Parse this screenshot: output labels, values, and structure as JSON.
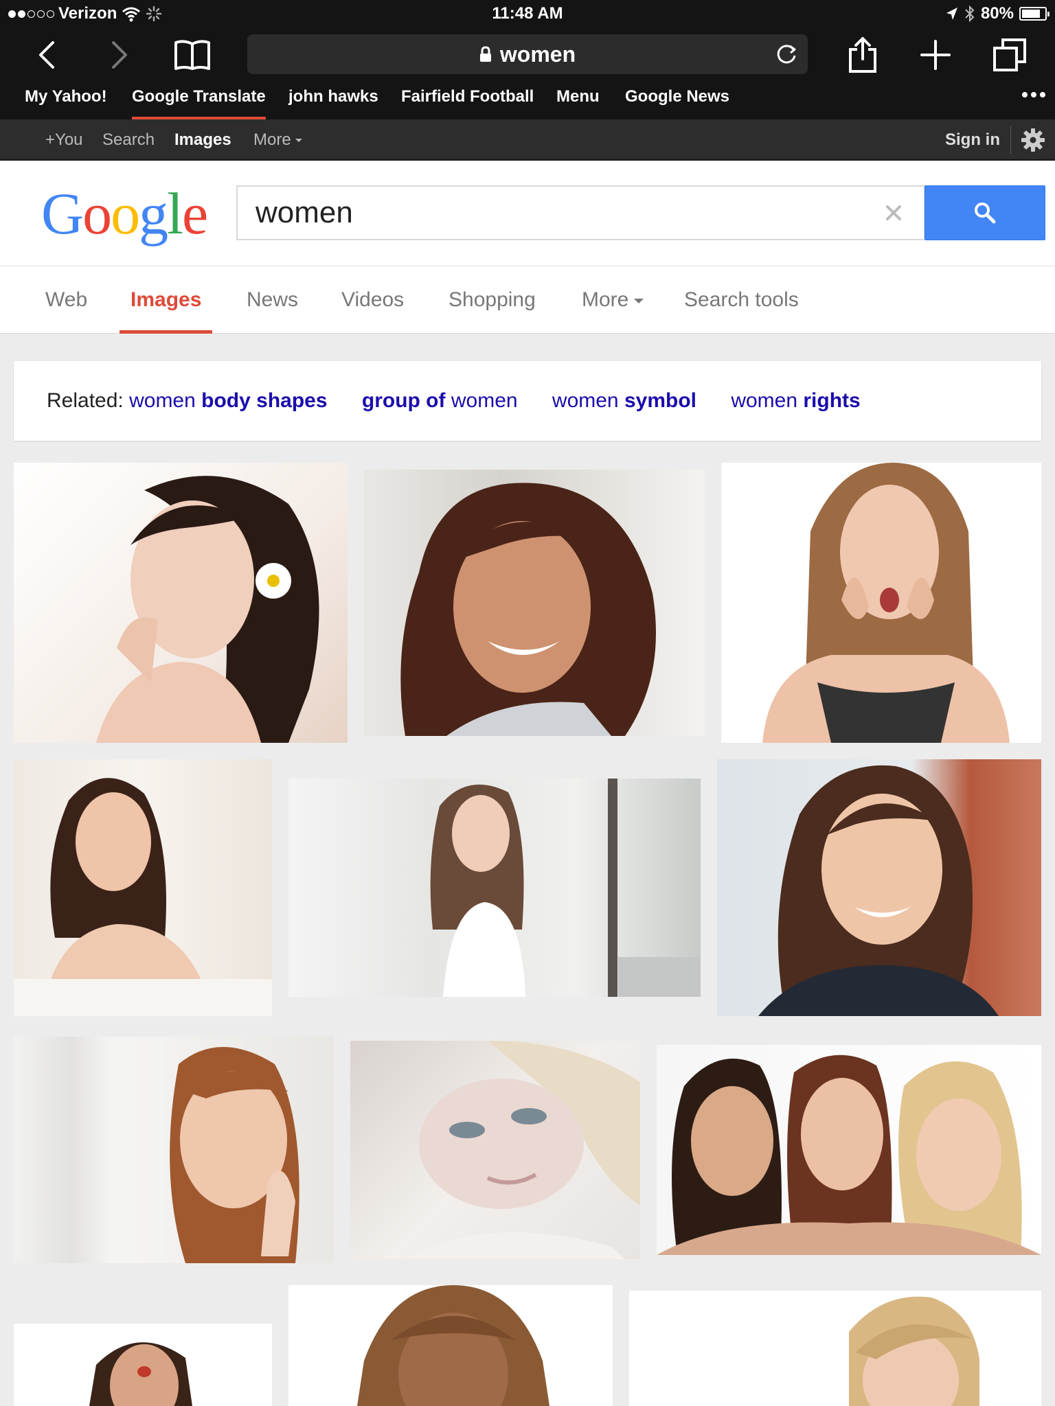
{
  "status_bar": {
    "carrier": "Verizon",
    "time": "11:48 AM",
    "battery_percent": "80%",
    "battery_level": 0.8,
    "icons": [
      "wifi-icon",
      "activity-spinner-icon",
      "location-arrow-icon",
      "bluetooth-icon",
      "battery-icon"
    ]
  },
  "toolbar": {
    "url": "women",
    "icons": [
      "back-icon",
      "forward-icon",
      "bookmarks-icon",
      "lock-icon",
      "reload-icon",
      "share-icon",
      "new-tab-icon",
      "tabs-icon"
    ]
  },
  "favorites": {
    "items": [
      "My Yahoo!",
      "Google Translate",
      "john hawks",
      "Fairfield Football",
      "Menu",
      "Google News"
    ],
    "active_index": 1
  },
  "google_bar": {
    "links": [
      "+You",
      "Search",
      "Images",
      "More"
    ],
    "active": "Images",
    "sign_in": "Sign in"
  },
  "search": {
    "logo": "Google",
    "logo_colors": [
      "#4285f4",
      "#ea4335",
      "#fbbc05",
      "#4285f4",
      "#34a853",
      "#ea4335"
    ],
    "query": "women",
    "button_color": "#4285f4"
  },
  "tabs": {
    "items": [
      "Web",
      "Images",
      "News",
      "Videos",
      "Shopping",
      "More",
      "Search tools"
    ],
    "active": "Images",
    "accent": "#dd4b39"
  },
  "related": {
    "label": "Related:",
    "items": [
      {
        "plain": "women ",
        "bold": "body shapes"
      },
      {
        "bold": "group of",
        "plain": " women"
      },
      {
        "plain": "women ",
        "bold": "symbol"
      },
      {
        "plain": "women ",
        "bold": "rights"
      }
    ],
    "link_color": "#1a0dab"
  }
}
